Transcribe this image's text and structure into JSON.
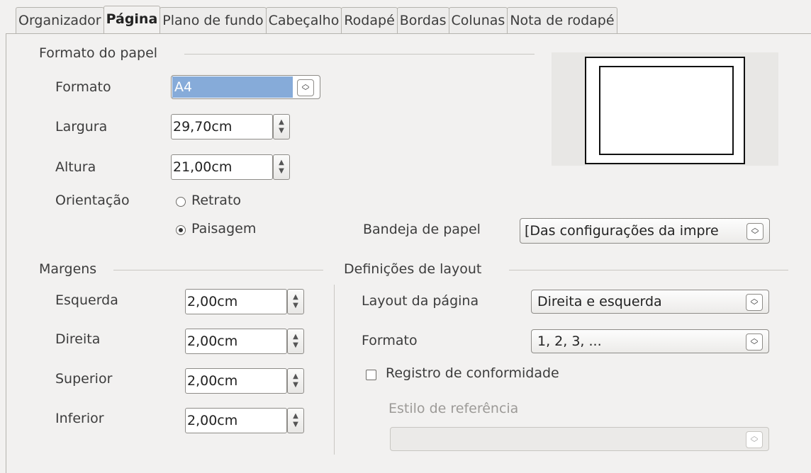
{
  "tabs": [
    "Organizador",
    "Página",
    "Plano de fundo",
    "Cabeçalho",
    "Rodapé",
    "Bordas",
    "Colunas",
    "Nota de rodapé"
  ],
  "active_tab": "Página",
  "paper_format": {
    "section_title": "Formato do papel",
    "format_label": "Formato",
    "format_value": "A4",
    "width_label": "Largura",
    "width_value": "29,70cm",
    "height_label": "Altura",
    "height_value": "21,00cm",
    "orientation_label": "Orientação",
    "portrait_label": "Retrato",
    "landscape_label": "Paisagem",
    "orientation_selected": "landscape",
    "paper_tray_label": "Bandeja de papel",
    "paper_tray_value": "[Das configurações da impre"
  },
  "margins": {
    "section_title": "Margens",
    "left_label": "Esquerda",
    "left_value": "2,00cm",
    "right_label": "Direita",
    "right_value": "2,00cm",
    "top_label": "Superior",
    "top_value": "2,00cm",
    "bottom_label": "Inferior",
    "bottom_value": "2,00cm"
  },
  "layout": {
    "section_title": "Definições de layout",
    "page_layout_label": "Layout da página",
    "page_layout_value": "Direita e esquerda",
    "format_label": "Formato",
    "format_value": "1, 2, 3, ...",
    "register_true_label": "Registro de conformidade",
    "register_true_checked": false,
    "reference_style_label": "Estilo de referência",
    "reference_style_value": ""
  },
  "colors": {
    "selection": "#86abd9",
    "background": "#f2f1f0"
  }
}
